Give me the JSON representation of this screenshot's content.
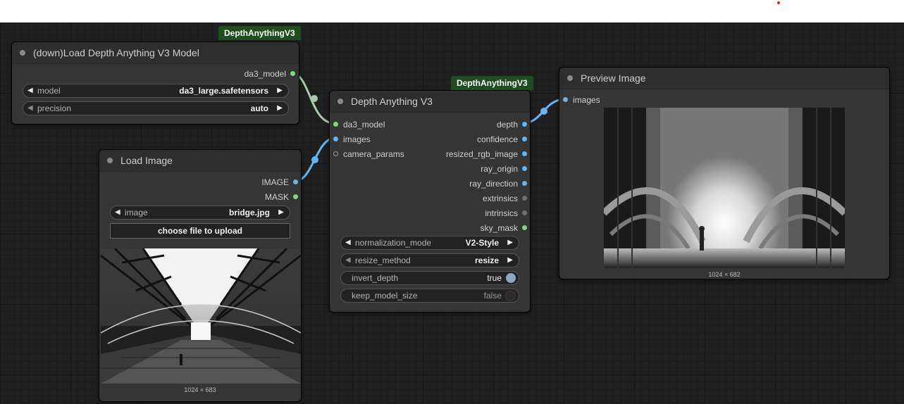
{
  "groups": {
    "depth_group_label": "DepthAnythingV3"
  },
  "load_model_node": {
    "title": "(down)Load Depth Anything V3 Model",
    "output": "da3_model",
    "model": {
      "label": "model",
      "value": "da3_large.safetensors"
    },
    "precision": {
      "label": "precision",
      "value": "auto"
    }
  },
  "load_image_node": {
    "title": "Load Image",
    "outputs": [
      "IMAGE",
      "MASK"
    ],
    "image": {
      "label": "image",
      "value": "bridge.jpg"
    },
    "upload_button": "choose file to upload",
    "caption": "1024 × 683"
  },
  "depth_node": {
    "title": "Depth Anything V3",
    "inputs": [
      "da3_model",
      "images",
      "camera_params"
    ],
    "outputs": [
      "depth",
      "confidence",
      "resized_rgb_image",
      "ray_origin",
      "ray_direction",
      "extrinsics",
      "intrinsics",
      "sky_mask"
    ],
    "normalization_mode": {
      "label": "normalization_mode",
      "value": "V2-Style"
    },
    "resize_method": {
      "label": "resize_method",
      "value": "resize"
    },
    "invert_depth": {
      "label": "invert_depth",
      "value": "true"
    },
    "keep_model_size": {
      "label": "keep_model_size",
      "value": "false"
    }
  },
  "preview_node": {
    "title": "Preview Image",
    "input": "images",
    "caption": "1024 × 682"
  },
  "colors": {
    "link_model": "#a8c8a8",
    "link_image": "#64b5f6",
    "group_badge": "#1f4d1f"
  }
}
